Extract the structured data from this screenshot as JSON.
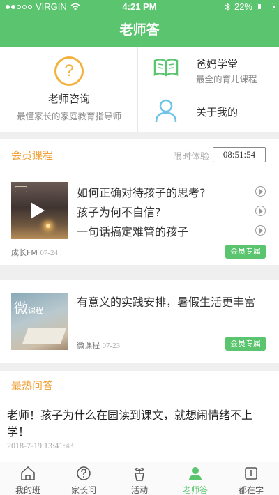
{
  "status_bar": {
    "carrier": "VIRGIN",
    "time": "4:21 PM",
    "battery": "22%",
    "battery_level": 0.22
  },
  "header": {
    "title": "老师答"
  },
  "top": {
    "consult": {
      "title": "老师咨询",
      "subtitle": "最懂家长的家庭教育指导师",
      "icon": "question-circle-icon"
    },
    "school": {
      "title": "爸妈学堂",
      "subtitle": "最全的育儿课程",
      "icon": "open-book-icon"
    },
    "about": {
      "title": "关于我的",
      "icon": "user-icon"
    }
  },
  "member": {
    "title": "会员课程",
    "limit_label": "限时体验",
    "timer": "08:51:54",
    "card1": {
      "thumb_logo": "FM",
      "lessons": [
        "如何正确对待孩子的思考?",
        "孩子为何不自信?",
        "一句话搞定难管的孩子"
      ],
      "source": "成长FM",
      "date": "07-24",
      "badge": "会员专属"
    },
    "card2": {
      "thumb_text": "微",
      "thumb_sub": "课程",
      "title": "有意义的实践安排，暑假生活更丰富",
      "source": "微课程",
      "date": "07-23",
      "badge": "会员专属"
    }
  },
  "hot": {
    "title": "最热问答",
    "question": "老师！孩子为什么在园读到课文，就想闹情绪不上学！",
    "time": "2018-7-19 13:41:43"
  },
  "tabs": [
    {
      "label": "我的班",
      "icon": "home-icon"
    },
    {
      "label": "家长问",
      "icon": "question-icon"
    },
    {
      "label": "活动",
      "icon": "plant-icon"
    },
    {
      "label": "老师答",
      "icon": "teacher-icon",
      "active": true
    },
    {
      "label": "都在学",
      "icon": "book-icon"
    }
  ],
  "colors": {
    "brand": "#5ac56e",
    "accent": "#f0a23a",
    "icon_blue": "#6ec3e6"
  }
}
